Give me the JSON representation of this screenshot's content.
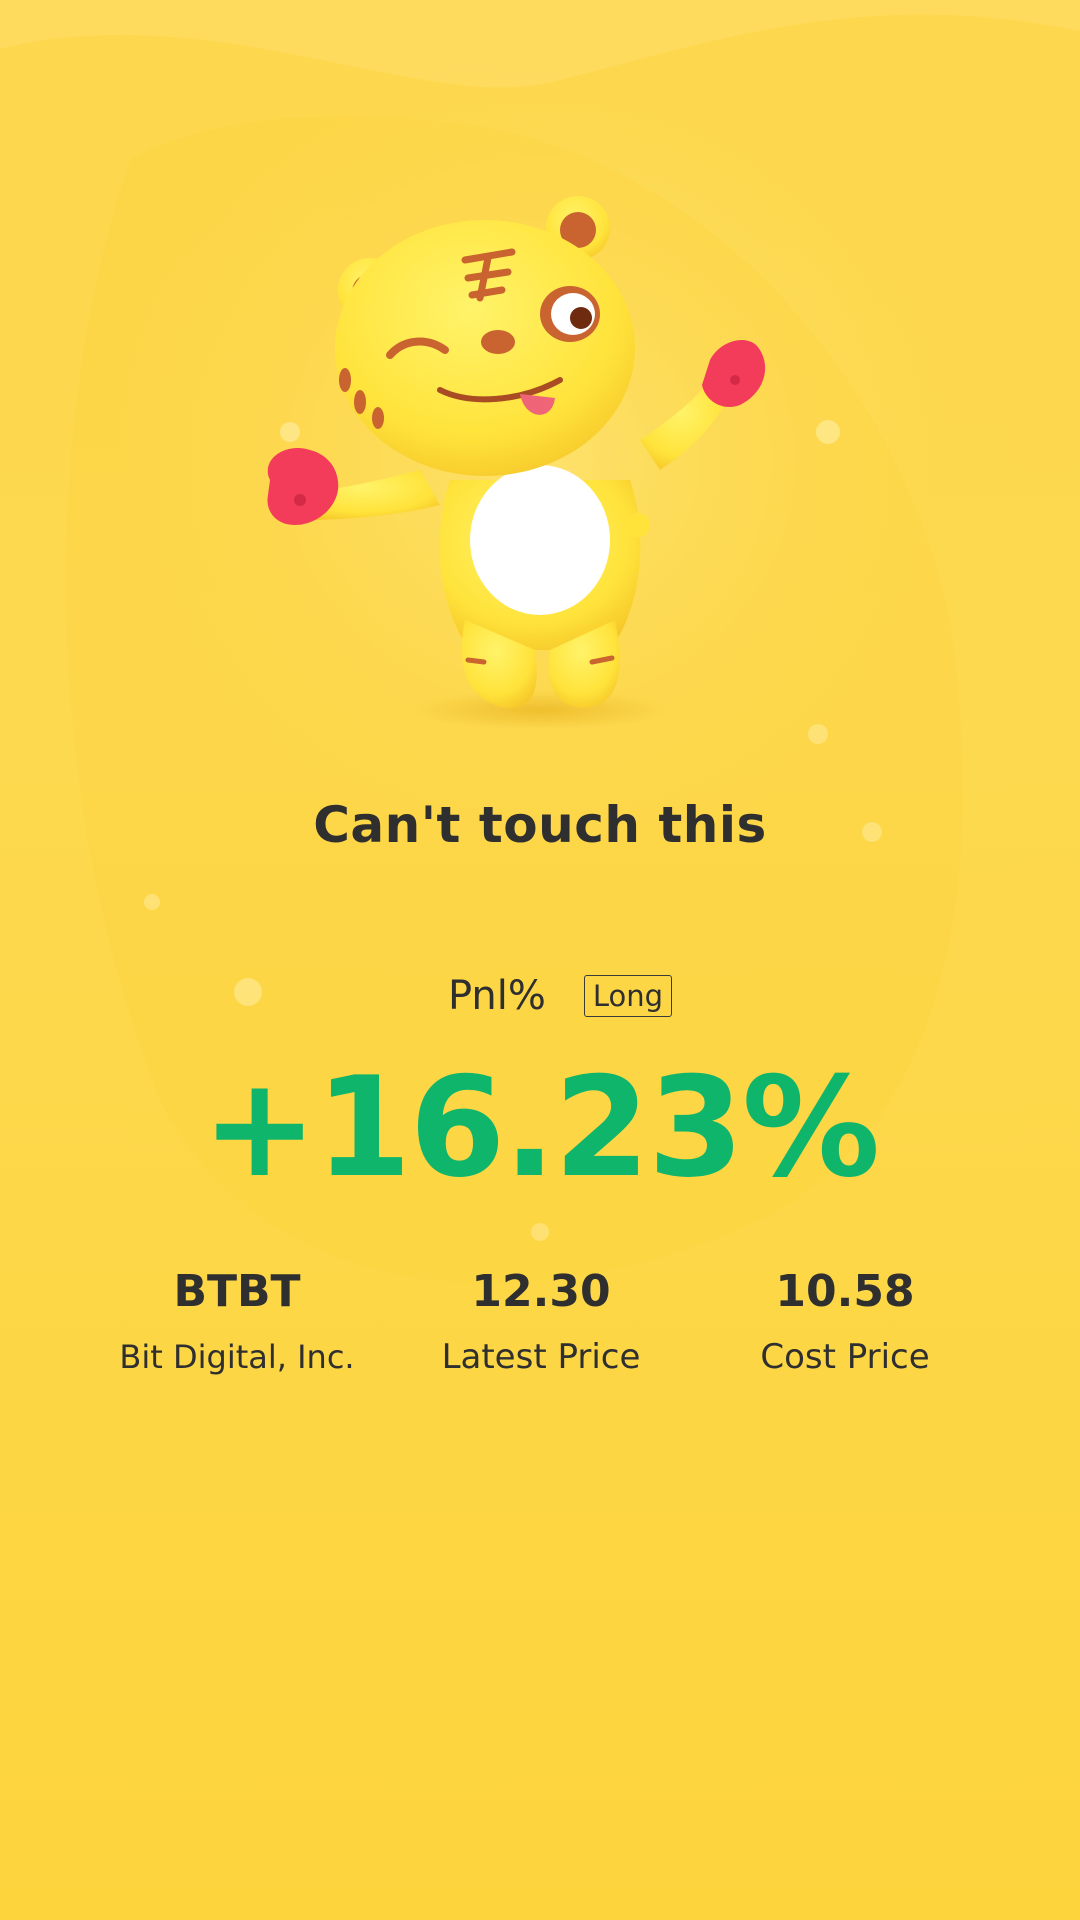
{
  "headline": "Can't touch this",
  "pnl": {
    "label": "Pnl%",
    "side": "Long",
    "value": "+16.23%"
  },
  "stats": {
    "ticker": {
      "value": "BTBT",
      "label": "Bit Digital, Inc."
    },
    "latest": {
      "value": "12.30",
      "label": "Latest Price"
    },
    "cost": {
      "value": "10.58",
      "label": "Cost Price"
    }
  },
  "mascot": {
    "icon": "tiger-mascot-icon"
  },
  "colors": {
    "background": "#fdd84e",
    "profit": "#0fb56a",
    "text": "#2f2f2f"
  }
}
